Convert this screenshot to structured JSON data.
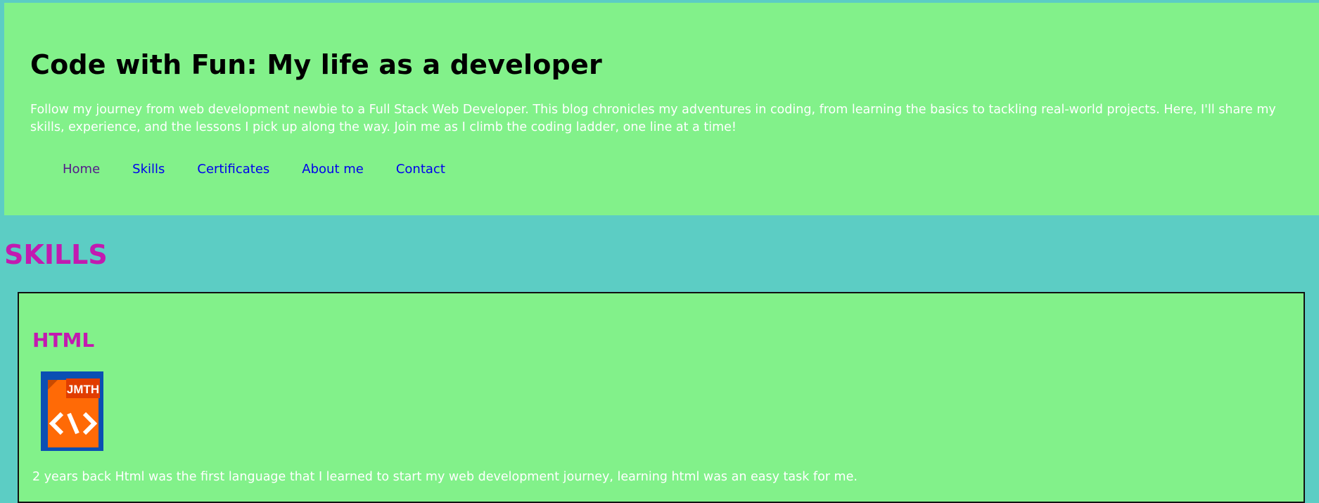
{
  "header": {
    "title": "Code with Fun: My life as a developer",
    "description": "Follow my journey from web development newbie to a Full Stack Web Developer. This blog chronicles my adventures in coding, from learning the basics to tackling real-world projects. Here, I'll share my skills, experience, and the lessons I pick up along the way. Join me as I climb the coding ladder, one line at a time!"
  },
  "nav": {
    "items": [
      {
        "label": "Home"
      },
      {
        "label": "Skills"
      },
      {
        "label": "Certificates"
      },
      {
        "label": "About me"
      },
      {
        "label": "Contact"
      }
    ]
  },
  "section": {
    "title": "SKILLS"
  },
  "skills": [
    {
      "title": "HTML",
      "icon": "html-file-icon",
      "icon_badge": "JMTH",
      "description": "2 years back Html was the first language that I learned to start my web development journey, learning html was an easy task for me."
    }
  ],
  "colors": {
    "page_bg": "#5ccdc4",
    "panel_bg": "#82f18a",
    "accent": "#c21ab0",
    "link": "#0000ee",
    "visited_link": "#551a8b"
  }
}
